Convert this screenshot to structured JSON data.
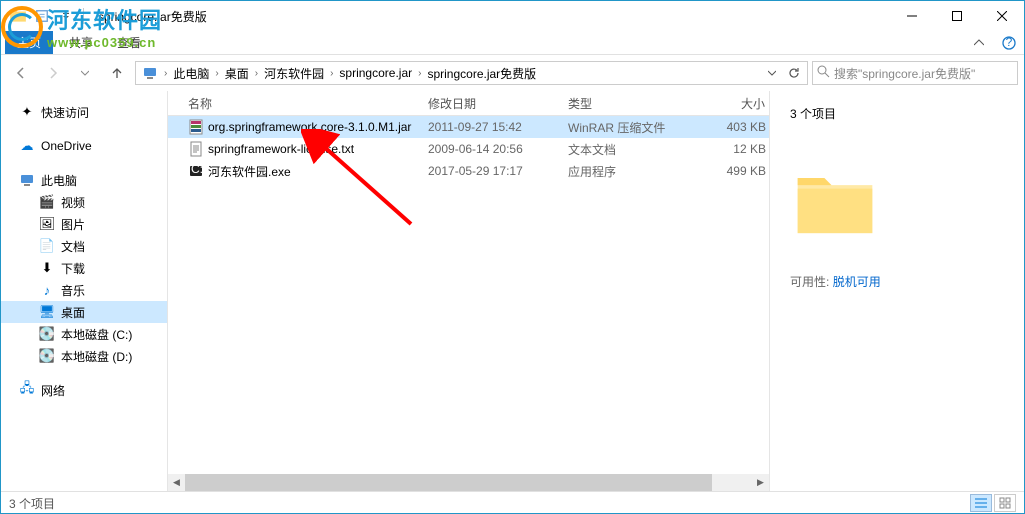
{
  "watermark": {
    "cn": "河东软件园",
    "url": "www.pc0359.cn"
  },
  "window": {
    "title": "springcore.jar免费版"
  },
  "ribbon": {
    "menu": "主页",
    "tabs": [
      "共享",
      "查看"
    ]
  },
  "breadcrumb": [
    "此电脑",
    "桌面",
    "河东软件园",
    "springcore.jar",
    "springcore.jar免费版"
  ],
  "search": {
    "placeholder": "搜索\"springcore.jar免费版\""
  },
  "sidebar": {
    "quick": "快速访问",
    "onedrive": "OneDrive",
    "thispc": "此电脑",
    "items": [
      "视频",
      "图片",
      "文档",
      "下载",
      "音乐",
      "桌面",
      "本地磁盘 (C:)",
      "本地磁盘 (D:)"
    ],
    "network": "网络"
  },
  "columns": {
    "name": "名称",
    "date": "修改日期",
    "type": "类型",
    "size": "大小"
  },
  "files": [
    {
      "name": "org.springframework.core-3.1.0.M1.jar",
      "date": "2011-09-27 15:42",
      "type": "WinRAR 压缩文件",
      "size": "403 KB",
      "icon": "rar",
      "selected": true
    },
    {
      "name": "springframework-license.txt",
      "date": "2009-06-14 20:56",
      "type": "文本文档",
      "size": "12 KB",
      "icon": "txt",
      "selected": false
    },
    {
      "name": "河东软件园.exe",
      "date": "2017-05-29 17:17",
      "type": "应用程序",
      "size": "499 KB",
      "icon": "exe",
      "selected": false
    }
  ],
  "preview": {
    "title": "3 个项目",
    "avail_label": "可用性:",
    "avail_value": "脱机可用"
  },
  "status": {
    "text": "3 个项目"
  }
}
